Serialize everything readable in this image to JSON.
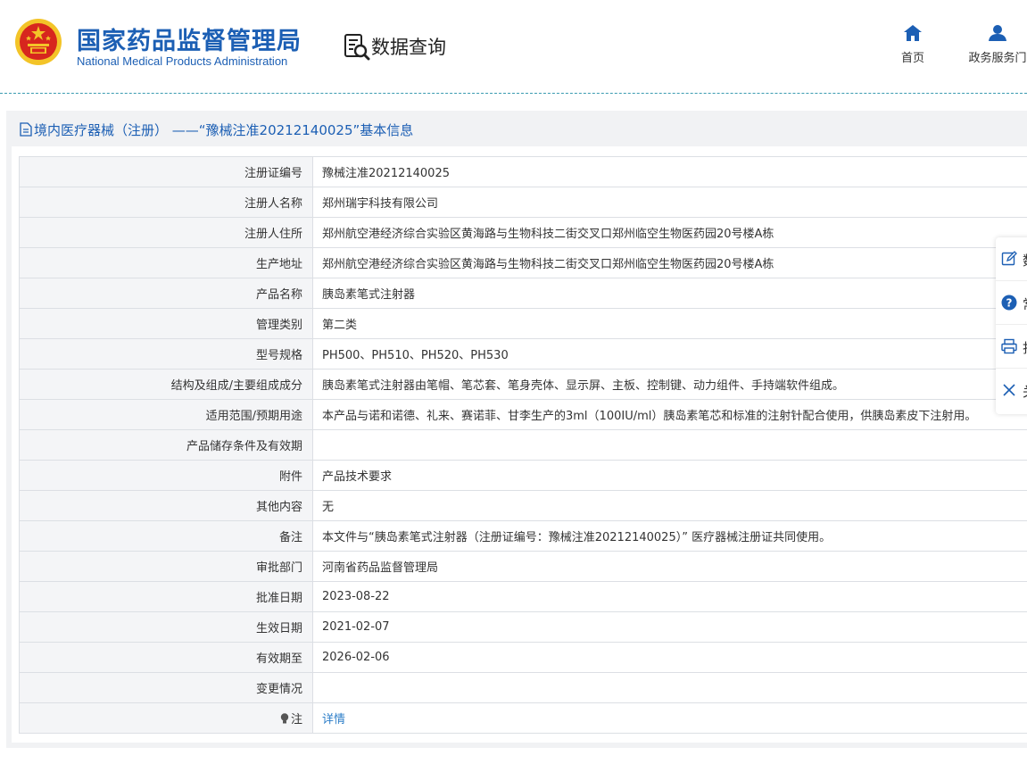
{
  "header": {
    "org_cn": "国家药品监督管理局",
    "org_en": "National Medical Products Administration",
    "section": "数据查询",
    "nav": [
      {
        "label": "首页",
        "icon": "home-icon"
      },
      {
        "label": "政务服务门",
        "icon": "user-icon"
      }
    ]
  },
  "panel": {
    "title": "境内医疗器械（注册） ——“豫械注准20212140025”基本信息"
  },
  "rows": [
    {
      "label": "注册证编号",
      "value": "豫械注准20212140025"
    },
    {
      "label": "注册人名称",
      "value": "郑州瑞宇科技有限公司"
    },
    {
      "label": "注册人住所",
      "value": "郑州航空港经济综合实验区黄海路与生物科技二街交叉口郑州临空生物医药园20号楼A栋"
    },
    {
      "label": "生产地址",
      "value": "郑州航空港经济综合实验区黄海路与生物科技二街交叉口郑州临空生物医药园20号楼A栋"
    },
    {
      "label": "产品名称",
      "value": "胰岛素笔式注射器"
    },
    {
      "label": "管理类别",
      "value": "第二类"
    },
    {
      "label": "型号规格",
      "value": "PH500、PH510、PH520、PH530"
    },
    {
      "label": "结构及组成/主要组成成分",
      "value": "胰岛素笔式注射器由笔帽、笔芯套、笔身壳体、显示屏、主板、控制键、动力组件、手持端软件组成。"
    },
    {
      "label": "适用范围/预期用途",
      "value": "本产品与诺和诺德、礼来、赛诺菲、甘李生产的3ml（100IU/ml）胰岛素笔芯和标准的注射针配合使用，供胰岛素皮下注射用。"
    },
    {
      "label": "产品储存条件及有效期",
      "value": ""
    },
    {
      "label": "附件",
      "value": "产品技术要求"
    },
    {
      "label": "其他内容",
      "value": "无"
    },
    {
      "label": "备注",
      "value": "本文件与“胰岛素笔式注射器（注册证编号：豫械注准20212140025）” 医疗器械注册证共同使用。"
    },
    {
      "label": "审批部门",
      "value": "河南省药品监督管理局"
    },
    {
      "label": "批准日期",
      "value": "2023-08-22"
    },
    {
      "label": "生效日期",
      "value": "2021-02-07"
    },
    {
      "label": "有效期至",
      "value": "2026-02-06"
    },
    {
      "label": "变更情况",
      "value": ""
    }
  ],
  "note_row": {
    "label": "注",
    "value": "详情"
  },
  "float_bar": [
    {
      "icon": "edit-icon",
      "label": "数"
    },
    {
      "icon": "help-icon",
      "label": "常"
    },
    {
      "icon": "print-icon",
      "label": "打"
    },
    {
      "icon": "close-icon",
      "label": "关"
    }
  ],
  "colors": {
    "brand": "#1c5fb4",
    "link": "#2c7ec8",
    "emblem_red": "#d7261e",
    "emblem_gold": "#f3c428"
  }
}
